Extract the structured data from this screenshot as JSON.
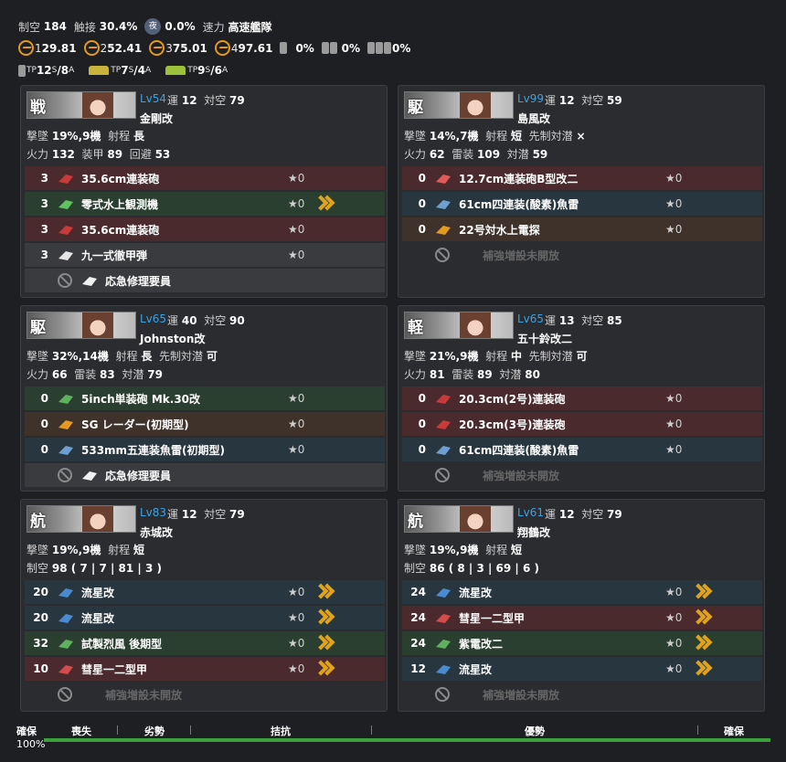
{
  "header": {
    "air_power_label": "制空",
    "air_power": "184",
    "contact_label": "触接",
    "contact": "30.4%",
    "radar_icon": "radar-icon",
    "radar_value": "0.0%",
    "speed_label": "速力",
    "speed": "高速艦隊",
    "los": [
      {
        "n": "1",
        "v": "29.81"
      },
      {
        "n": "2",
        "v": "52.41"
      },
      {
        "n": "3",
        "v": "75.01"
      },
      {
        "n": "4",
        "v": "97.61"
      }
    ],
    "drum1": "0%",
    "drum2": "0%",
    "drum3": "0%",
    "tp1": {
      "a": "12",
      "as": "S",
      "sep": " / ",
      "b": "8",
      "bs": "A"
    },
    "tp2": {
      "a": "7",
      "as": "S",
      "sep": " / ",
      "b": "4",
      "bs": "A"
    },
    "tp3": {
      "a": "9",
      "as": "S",
      "sep": " / ",
      "b": "6",
      "bs": "A"
    }
  },
  "ships": [
    {
      "cls": "戦",
      "lv": "Lv54",
      "luck_label": "運",
      "luck": "12",
      "aa_label": "対空",
      "aa": "79",
      "name": "金剛改",
      "line2": [
        {
          "l": "撃墜",
          "v": "19%,9機"
        },
        {
          "l": "射程",
          "v": "長"
        }
      ],
      "line3": [
        {
          "l": "火力",
          "v": "132"
        },
        {
          "l": "装甲",
          "v": "89"
        },
        {
          "l": "回避",
          "v": "53"
        }
      ],
      "slots": [
        {
          "cnt": "3",
          "name": "35.6cm連装砲",
          "star": "★0",
          "color": "red",
          "icon": "main-gun-icon"
        },
        {
          "cnt": "3",
          "name": "零式水上観測機",
          "star": "★0",
          "color": "green",
          "icon": "seaplane-icon",
          "prof": true
        },
        {
          "cnt": "3",
          "name": "35.6cm連装砲",
          "star": "★0",
          "color": "red",
          "icon": "main-gun-icon"
        },
        {
          "cnt": "3",
          "name": "九一式徹甲弾",
          "star": "★0",
          "color": "gray",
          "icon": "ap-shell-icon"
        },
        {
          "cnt": "",
          "name": "応急修理要員",
          "star": "",
          "color": "gray",
          "icon": "repair-icon",
          "ban": true
        }
      ]
    },
    {
      "cls": "駆",
      "lv": "Lv99",
      "luck_label": "運",
      "luck": "12",
      "aa_label": "対空",
      "aa": "59",
      "name": "島風改",
      "line2": [
        {
          "l": "撃墜",
          "v": "14%,7機"
        },
        {
          "l": "射程",
          "v": "短"
        },
        {
          "l": "先制対潜",
          "v": "×"
        }
      ],
      "line3": [
        {
          "l": "火力",
          "v": "62"
        },
        {
          "l": "雷装",
          "v": "109"
        },
        {
          "l": "対潜",
          "v": "59"
        }
      ],
      "slots": [
        {
          "cnt": "0",
          "name": "12.7cm連装砲B型改二",
          "star": "★0",
          "color": "red",
          "icon": "small-gun-icon"
        },
        {
          "cnt": "0",
          "name": "61cm四連装(酸素)魚雷",
          "star": "★0",
          "color": "blue",
          "icon": "torpedo-icon"
        },
        {
          "cnt": "0",
          "name": "22号対水上電探",
          "star": "★0",
          "color": "brown",
          "icon": "radar-icon"
        },
        {
          "cnt": "",
          "name": "補強増設未開放",
          "star": "",
          "color": "empty",
          "icon": "",
          "ban": true
        }
      ]
    },
    {
      "cls": "駆",
      "lv": "Lv65",
      "luck_label": "運",
      "luck": "40",
      "aa_label": "対空",
      "aa": "90",
      "name": "Johnston改",
      "line2": [
        {
          "l": "撃墜",
          "v": "32%,14機"
        },
        {
          "l": "射程",
          "v": "長"
        },
        {
          "l": "先制対潜",
          "v": "可"
        }
      ],
      "line3": [
        {
          "l": "火力",
          "v": "66"
        },
        {
          "l": "雷装",
          "v": "83"
        },
        {
          "l": "対潜",
          "v": "79"
        }
      ],
      "slots": [
        {
          "cnt": "0",
          "name": "5inch単装砲 Mk.30改",
          "star": "★0",
          "color": "green",
          "icon": "dual-gun-icon"
        },
        {
          "cnt": "0",
          "name": "SG レーダー(初期型)",
          "star": "★0",
          "color": "brown",
          "icon": "radar-icon"
        },
        {
          "cnt": "0",
          "name": "533mm五連装魚雷(初期型)",
          "star": "★0",
          "color": "blue",
          "icon": "torpedo-icon"
        },
        {
          "cnt": "",
          "name": "応急修理要員",
          "star": "",
          "color": "gray",
          "icon": "repair-icon",
          "ban": true
        }
      ]
    },
    {
      "cls": "軽",
      "lv": "Lv65",
      "luck_label": "運",
      "luck": "13",
      "aa_label": "対空",
      "aa": "85",
      "name": "五十鈴改二",
      "line2": [
        {
          "l": "撃墜",
          "v": "21%,9機"
        },
        {
          "l": "射程",
          "v": "中"
        },
        {
          "l": "先制対潜",
          "v": "可"
        }
      ],
      "line3": [
        {
          "l": "火力",
          "v": "81"
        },
        {
          "l": "雷装",
          "v": "89"
        },
        {
          "l": "対潜",
          "v": "80"
        }
      ],
      "slots": [
        {
          "cnt": "0",
          "name": "20.3cm(2号)連装砲",
          "star": "★0",
          "color": "red",
          "icon": "main-gun-icon"
        },
        {
          "cnt": "0",
          "name": "20.3cm(3号)連装砲",
          "star": "★0",
          "color": "red",
          "icon": "main-gun-icon"
        },
        {
          "cnt": "0",
          "name": "61cm四連装(酸素)魚雷",
          "star": "★0",
          "color": "blue",
          "icon": "torpedo-icon"
        },
        {
          "cnt": "",
          "name": "補強増設未開放",
          "star": "",
          "color": "empty",
          "icon": "",
          "ban": true
        }
      ]
    },
    {
      "cls": "航",
      "lv": "Lv83",
      "luck_label": "運",
      "luck": "12",
      "aa_label": "対空",
      "aa": "79",
      "name": "赤城改",
      "line2": [
        {
          "l": "撃墜",
          "v": "19%,9機"
        },
        {
          "l": "射程",
          "v": "短"
        }
      ],
      "line3": [
        {
          "l": "制空",
          "v": "98 ( 7 | 7 | 81 | 3 )"
        }
      ],
      "slots": [
        {
          "cnt": "20",
          "name": "流星改",
          "star": "★0",
          "color": "blue",
          "icon": "torpedo-bomber-icon",
          "prof": true
        },
        {
          "cnt": "20",
          "name": "流星改",
          "star": "★0",
          "color": "blue",
          "icon": "torpedo-bomber-icon",
          "prof": true
        },
        {
          "cnt": "32",
          "name": "試製烈風 後期型",
          "star": "★0",
          "color": "green",
          "icon": "fighter-icon",
          "prof": true
        },
        {
          "cnt": "10",
          "name": "彗星一二型甲",
          "star": "★0",
          "color": "red",
          "icon": "dive-bomber-icon",
          "prof": true
        },
        {
          "cnt": "",
          "name": "補強増設未開放",
          "star": "",
          "color": "empty",
          "icon": "",
          "ban": true
        }
      ]
    },
    {
      "cls": "航",
      "lv": "Lv61",
      "luck_label": "運",
      "luck": "12",
      "aa_label": "対空",
      "aa": "79",
      "name": "翔鶴改",
      "line2": [
        {
          "l": "撃墜",
          "v": "19%,9機"
        },
        {
          "l": "射程",
          "v": "短"
        }
      ],
      "line3": [
        {
          "l": "制空",
          "v": "86 ( 8 | 3 | 69 | 6 )"
        }
      ],
      "slots": [
        {
          "cnt": "24",
          "name": "流星改",
          "star": "★0",
          "color": "blue",
          "icon": "torpedo-bomber-icon",
          "prof": true
        },
        {
          "cnt": "24",
          "name": "彗星一二型甲",
          "star": "★0",
          "color": "red",
          "icon": "dive-bomber-icon",
          "prof": true
        },
        {
          "cnt": "24",
          "name": "紫電改二",
          "star": "★0",
          "color": "green",
          "icon": "fighter-icon",
          "prof": true
        },
        {
          "cnt": "12",
          "name": "流星改",
          "star": "★0",
          "color": "blue",
          "icon": "torpedo-bomber-icon",
          "prof": true
        },
        {
          "cnt": "",
          "name": "補強増設未開放",
          "star": "",
          "color": "empty",
          "icon": "",
          "ban": true
        }
      ]
    }
  ],
  "airbar": {
    "secure_left": "確保",
    "percent": "100%",
    "labels": [
      "喪失",
      "劣勢",
      "拮抗",
      "優勢",
      "確保"
    ]
  }
}
